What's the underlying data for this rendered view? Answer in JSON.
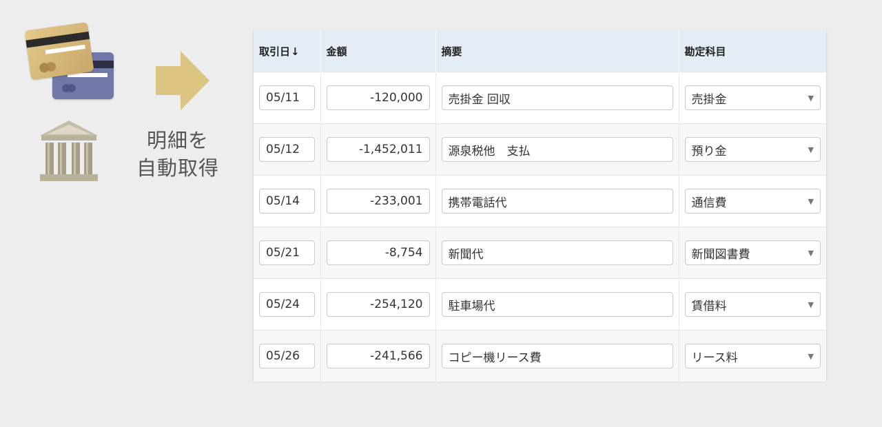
{
  "caption": {
    "line1": "明細を",
    "line2": "自動取得"
  },
  "table": {
    "headers": {
      "date": "取引日",
      "sort_icon": "↓",
      "amount": "金額",
      "summary": "摘要",
      "account": "勘定科目"
    },
    "rows": [
      {
        "date": "05/11",
        "amount": "-120,000",
        "summary": "売掛金 回収",
        "account": "売掛金"
      },
      {
        "date": "05/12",
        "amount": "-1,452,011",
        "summary": "源泉税他　支払",
        "account": "預り金"
      },
      {
        "date": "05/14",
        "amount": "-233,001",
        "summary": "携帯電話代",
        "account": "通信費"
      },
      {
        "date": "05/21",
        "amount": "-8,754",
        "summary": "新聞代",
        "account": "新聞図書費"
      },
      {
        "date": "05/24",
        "amount": "-254,120",
        "summary": "駐車場代",
        "account": "賃借料"
      },
      {
        "date": "05/26",
        "amount": "-241,566",
        "summary": "コピー機リース費",
        "account": "リース料"
      }
    ],
    "select_caret": "▼"
  },
  "icons": {
    "cards": "credit-card-icon",
    "bank": "bank-icon",
    "arrow": "arrow-right-icon"
  },
  "colors": {
    "header_bg": "#e4ecf6",
    "arrow": "#dcc483",
    "background": "#ededed"
  }
}
